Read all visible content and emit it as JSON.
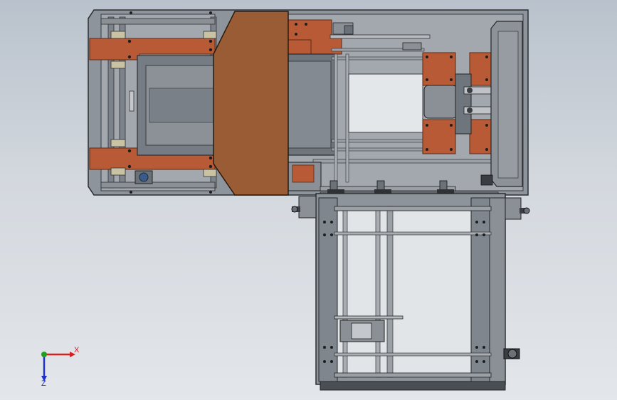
{
  "viewport": {
    "background_top": "#b9c2cc",
    "background_bottom": "#e3e6ea"
  },
  "colors": {
    "steel_light": "#9a9fa6",
    "steel_mid": "#7f858c",
    "steel_dark": "#5c6167",
    "frame_edge": "#2b2e31",
    "orange_plate": "#b85a36",
    "orange_plate_dark": "#8e3f22",
    "brown_cover": "#9a5c35",
    "glass": "#e4e7ea"
  },
  "triad": {
    "x_label": "X",
    "z_label": "Z",
    "x_color": "#d62020",
    "z_color": "#2030c8",
    "origin_color": "#1fa01f"
  }
}
